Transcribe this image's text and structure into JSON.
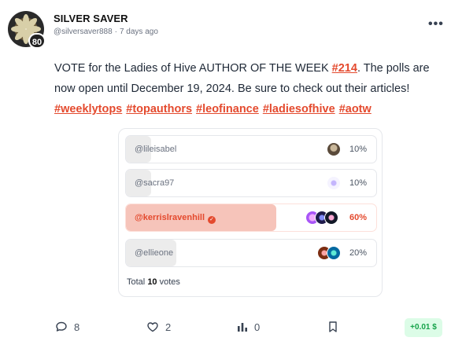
{
  "post": {
    "author": "SILVER SAVER",
    "handle": "@silversaver888",
    "separator": "·",
    "time": "7 days ago",
    "reputation": "80",
    "more_label": "•••",
    "text_before": "VOTE for the Ladies of Hive AUTHOR OF THE WEEK ",
    "week_link": "#214",
    "text_after": ". The polls are now open until December 19, 2024. Be sure to check out their articles!",
    "hashtags": [
      "#weeklytops",
      "#topauthors",
      "#leofinance",
      "#ladiesofhive",
      "#aotw"
    ]
  },
  "poll": {
    "options": [
      {
        "label": "@lileisabel",
        "percent_label": "10%",
        "percent": 10,
        "winner": false
      },
      {
        "label": "@sacra97",
        "percent_label": "10%",
        "percent": 10,
        "winner": false
      },
      {
        "label": "@kerrislravenhill",
        "percent_label": "60%",
        "percent": 60,
        "winner": true
      },
      {
        "label": "@ellieone",
        "percent_label": "20%",
        "percent": 20,
        "winner": false
      }
    ],
    "total_prefix": "Total",
    "total_count": "10",
    "total_suffix": "votes",
    "check_glyph": "✓"
  },
  "footer": {
    "comments": "8",
    "likes": "2",
    "votes": "0",
    "payout": "+0.01 $"
  },
  "colors": {
    "accent": "#e44a2e",
    "winner_fill": "#f6c4ba",
    "payout_bg": "#dcfce7",
    "payout_text": "#16a34a"
  }
}
